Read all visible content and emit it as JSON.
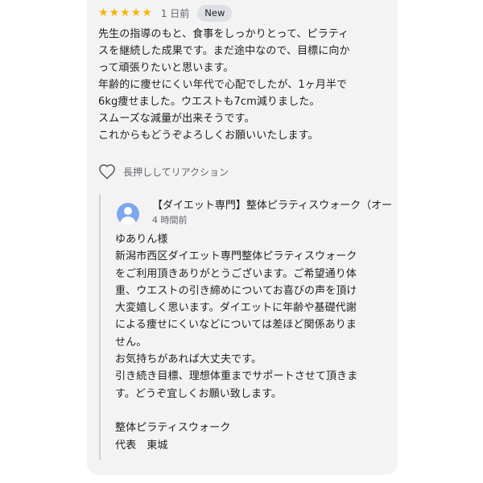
{
  "review": {
    "rating": 5,
    "stars": [
      "★",
      "★",
      "★",
      "★",
      "★"
    ],
    "time_ago": "1 日前",
    "badge": "New",
    "text": "先生の指導のもと、食事をしっかりとって、ピラティ\nスを継続した成果です。まだ途中なので、目標に向か\nって頑張りたいと思います。\n年齢的に痩せにくい年代で心配でしたが、1ヶ月半で\n6kg痩せました。ウエストも7cm減りました。\nスムーズな減量が出来そうです。\nこれからもどうぞよろしくお願いいたします。",
    "reaction_label": "長押ししてリアクション"
  },
  "reply": {
    "owner_name": "【ダイエット専門】整体ピラティスウォーク（オー",
    "time_ago": "4 時間前",
    "text": "ゆありん様\n新潟市西区ダイエット専門整体ピラティスウォーク\nをご利用頂きありがとうございます。ご希望通り体\n重、ウエストの引き締めについてお喜びの声を頂け\n大変嬉しく思います。ダイエットに年齢や基礎代謝\nによる痩せにくいなどについては差ほど関係ありま\nせん。\nお気持ちがあれば大丈夫です。\n引き続き目標、理想体重までサポートさせて頂きま\nす。どうぞ宜しくお願い致します。\n\n整体ピラティスウォーク\n代表　東城"
  },
  "icons": {
    "star": "star-icon",
    "heart": "heart-outline-icon",
    "avatar": "person-avatar-icon"
  },
  "colors": {
    "card_bg": "#f3f3f4",
    "star": "#f5b400",
    "badge_bg": "#dde0e5",
    "avatar_bg": "#7ea6ef",
    "reply_rule": "#cfd1d4"
  }
}
